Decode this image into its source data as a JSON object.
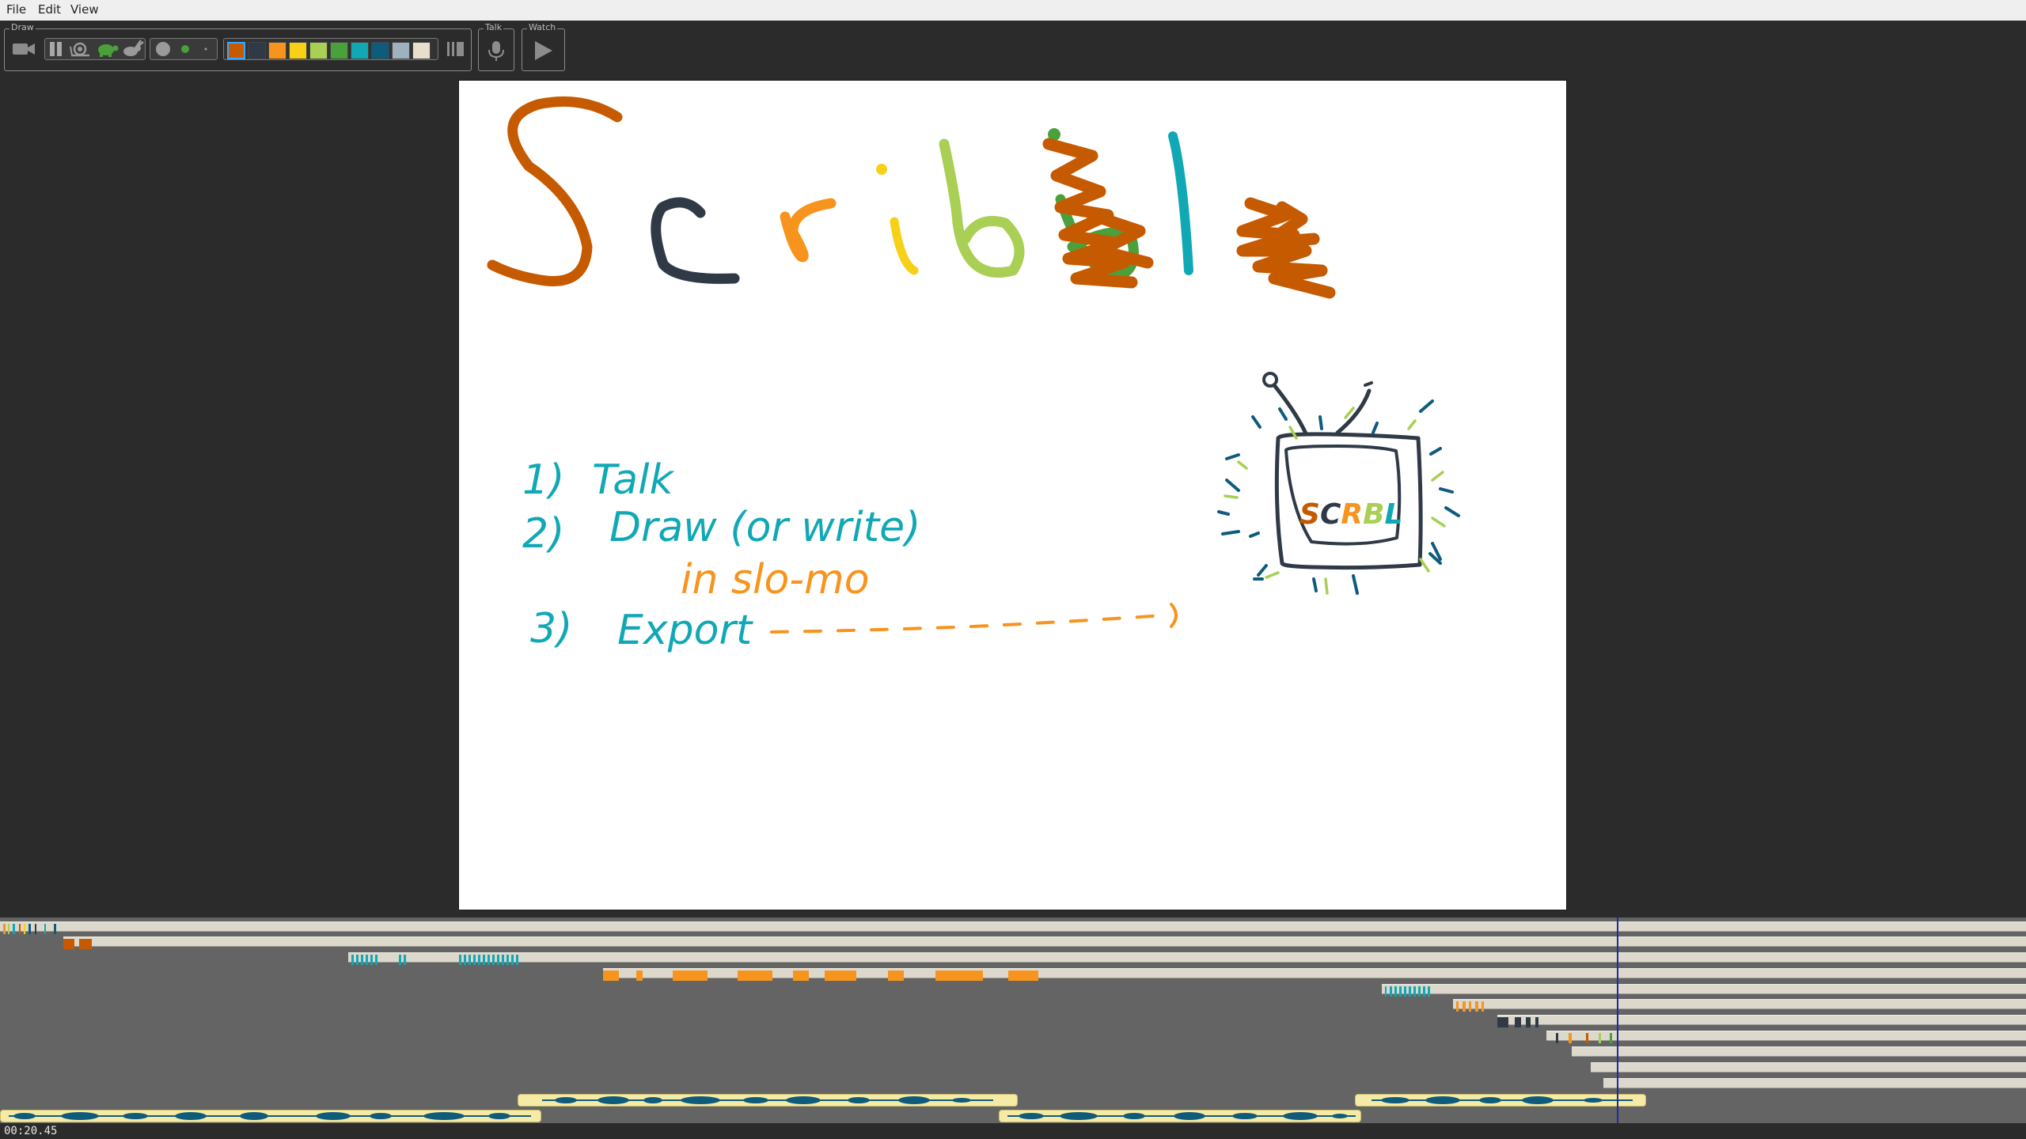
{
  "menu": {
    "file": "File",
    "edit": "Edit",
    "view": "View"
  },
  "toolbar": {
    "draw_label": "Draw",
    "talk_label": "Talk",
    "watch_label": "Watch",
    "camera_icon": "video-camera-icon",
    "pause_icon": "pause-icon",
    "speed_icons": [
      "snail-icon",
      "turtle-icon",
      "rabbit-icon"
    ],
    "brush_icons": [
      "large-brush-dot-icon",
      "medium-brush-dot-icon",
      "small-brush-dot-icon"
    ],
    "palette": [
      "#c65a00",
      "#303a46",
      "#f7941d",
      "#f7d117",
      "#a9cf54",
      "#4aa03b",
      "#11a8b6",
      "#0f5b7c",
      "#9fb1bd",
      "#e7dfcc"
    ],
    "selected_color": "#c65a00",
    "eraser_icon": "eraser-icon",
    "mic_icon": "microphone-icon",
    "play_icon": "play-icon"
  },
  "canvas": {
    "title_letters": [
      "S",
      "c",
      "r",
      "i",
      "b",
      "b",
      "l",
      "e"
    ],
    "title_colors": [
      "#c65a00",
      "#303a46",
      "#f7941d",
      "#f7d117",
      "#a9cf54",
      "#c65a00",
      "#11a8b6",
      "#c65a00"
    ],
    "steps": [
      {
        "number": "1)",
        "text": "Talk"
      },
      {
        "number": "2)",
        "text": "Draw (or write)"
      },
      {
        "number": "",
        "text": "in slo-mo"
      },
      {
        "number": "3)",
        "text": "Export"
      }
    ],
    "tv_screen_text": "SCRBL"
  },
  "timeline": {
    "playhead_time": "00:20.45"
  },
  "colors": {
    "background": "#2b2b2b",
    "timeline_bg": "#646464",
    "track": "#dcd9cc",
    "audio_clip": "#f6eba5",
    "waveform": "#0f5b7c",
    "playhead": "#1f2a9e"
  }
}
